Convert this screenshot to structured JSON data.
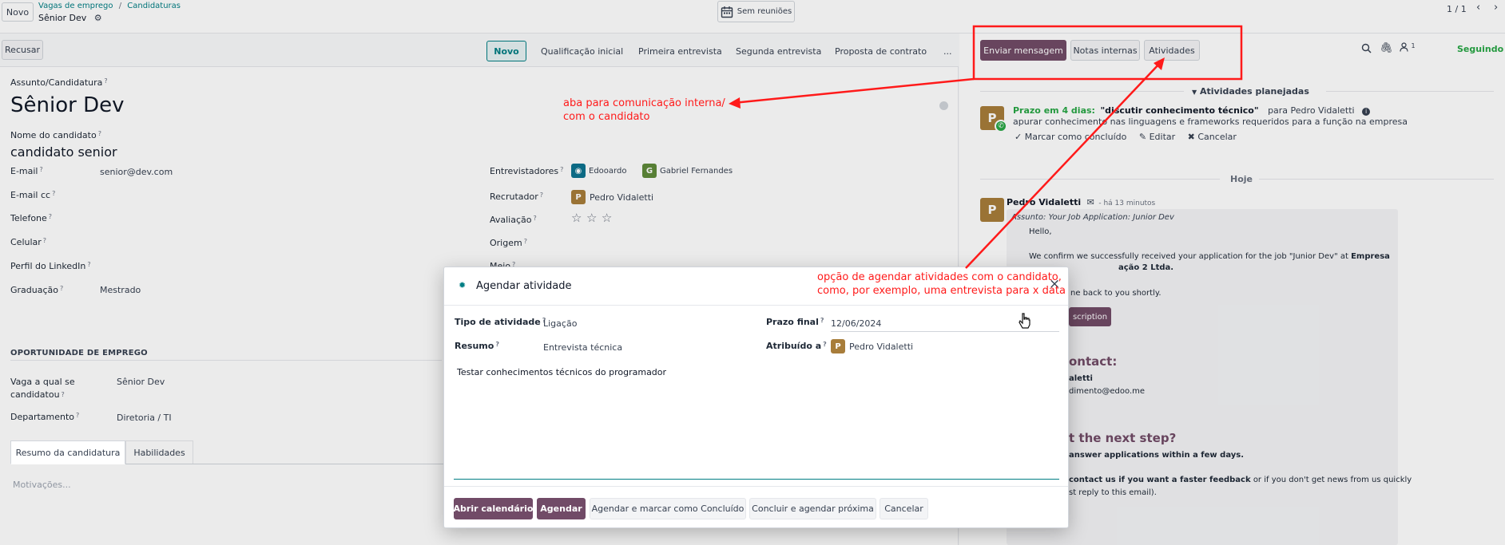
{
  "topbar": {
    "new_label": "Novo",
    "breadcrumb_1": "Vagas de emprego",
    "breadcrumb_sep": "/",
    "breadcrumb_2": "Candidaturas",
    "record_title": "Sênior Dev",
    "meetings_label": "Sem reuniões",
    "pager": "1 / 1"
  },
  "statusbar": {
    "refuse_label": "Recusar",
    "stages": [
      "Novo",
      "Qualificação inicial",
      "Primeira entrevista",
      "Segunda entrevista",
      "Proposta de contrato",
      "..."
    ]
  },
  "chatter": {
    "send_message": "Enviar mensagem",
    "internal_notes": "Notas internas",
    "activities": "Atividades",
    "following": "Seguindo",
    "followers_count": "1",
    "planned_header": "Atividades planejadas",
    "activity": {
      "avatar": "P",
      "due": "Prazo em 4 dias:",
      "title": "\"discutir conhecimento técnico\"",
      "for": "para Pedro Vidaletti",
      "desc": "apurar conhecimento nas linguagens e frameworks  requeridos para a função na empresa",
      "done": "Marcar como concluído",
      "edit": "Editar",
      "cancel": "Cancelar"
    },
    "today": "Hoje",
    "message": {
      "avatar": "P",
      "author": "Pedro Vidaletti",
      "time": "- há 13 minutos",
      "subject": "Assunto: Your Job Application: Junior Dev",
      "hello": "Hello,",
      "body_1": "We confirm we successfully received your application for the job \"Junior Dev\" at",
      "body_1_bold": "Empresa",
      "body_2_bold": "ação 2 Ltda.",
      "body_3": "ne back to you shortly.",
      "button": "scription",
      "contact_heading": "ontact:",
      "contact_name": "aletti",
      "contact_email": "dimento@edoo.me",
      "next_step": "t the next step?",
      "next_1": "answer applications within a few days.",
      "next_2_bold": "contact us if you want a faster feedback",
      "next_2": "or if you don't get news from us quickly",
      "next_3": "st reply to this email)."
    }
  },
  "form": {
    "subject_label": "Assunto/Candidatura",
    "subject_value": "Sênior Dev",
    "candidate_label": "Nome do candidato",
    "candidate_value": "candidato senior",
    "email_label": "E-mail",
    "email_value": "senior@dev.com",
    "email_cc_label": "E-mail cc",
    "phone_label": "Telefone",
    "mobile_label": "Celular",
    "linkedin_label": "Perfil do LinkedIn",
    "degree_label": "Graduação",
    "degree_value": "Mestrado",
    "interviewers_label": "Entrevistadores",
    "interviewer_1": "Edooardo",
    "interviewer_2_avatar": "G",
    "interviewer_2": "Gabriel Fernandes",
    "recruiter_label": "Recrutador",
    "recruiter_avatar": "P",
    "recruiter_value": "Pedro Vidaletti",
    "rating_label": "Avaliação",
    "origin_label": "Origem",
    "medium_label": "Meio",
    "job_section": "OPORTUNIDADE DE EMPREGO",
    "job_label_1": "Vaga a qual se",
    "job_label_2": "candidatou",
    "job_value": "Sênior Dev",
    "department_label": "Departamento",
    "department_value": "Diretoria / TI",
    "tab_summary": "Resumo da candidatura",
    "tab_skills": "Habilidades",
    "motivation_placeholder": "Motivações..."
  },
  "modal": {
    "title": "Agendar atividade",
    "close": "×",
    "type_label": "Tipo de atividade",
    "type_value": "Ligação",
    "summary_label": "Resumo",
    "summary_value": "Entrevista técnica",
    "due_label": "Prazo final",
    "due_value": "12/06/2024",
    "assigned_label": "Atribuído a",
    "assigned_avatar": "P",
    "assigned_value": "Pedro Vidaletti",
    "note": "Testar conhecimentos técnicos do programador",
    "btn_calendar": "Abrir calendário",
    "btn_schedule": "Agendar",
    "btn_schedule_done": "Agendar e marcar como Concluído",
    "btn_done_next": "Concluir e agendar próxima",
    "btn_cancel": "Cancelar"
  },
  "annotations": {
    "a1_line1": "aba para comunicação interna/",
    "a1_line2": "com o candidato",
    "a2_line1": "opção de agendar atividades com o candidato,",
    "a2_line2": "como, por exemplo, uma entrevista para x data"
  },
  "colors": {
    "brand": "#714b67",
    "teal": "#017e84",
    "annotation": "#ff1a1a"
  }
}
